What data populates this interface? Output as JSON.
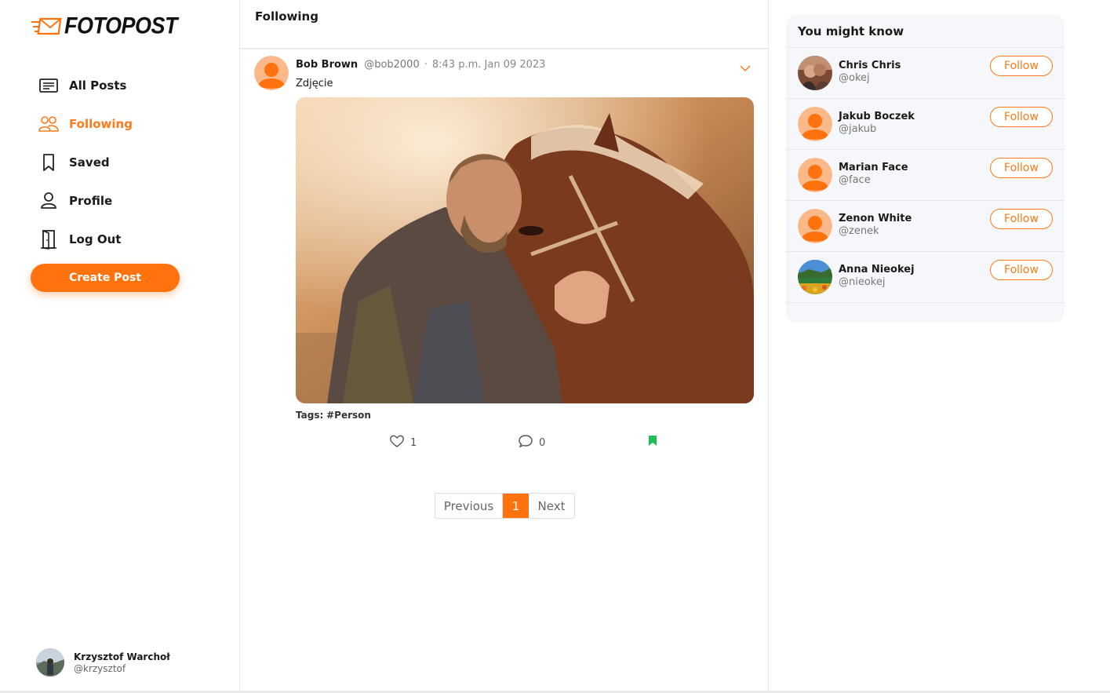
{
  "brand": {
    "name": "FOTOPOST",
    "accent": "#ff720d"
  },
  "sidebar": {
    "items": [
      {
        "label": "All Posts",
        "icon": "document-lines-icon",
        "active": false
      },
      {
        "label": "Following",
        "icon": "people-icon",
        "active": true
      },
      {
        "label": "Saved",
        "icon": "bookmark-icon",
        "active": false
      },
      {
        "label": "Profile",
        "icon": "user-icon",
        "active": false
      },
      {
        "label": "Log Out",
        "icon": "door-exit-icon",
        "active": false
      }
    ],
    "create_label": "Create Post",
    "current_user": {
      "name": "Krzysztof Warchoł",
      "handle": "@krzysztof"
    }
  },
  "feed": {
    "title": "Following",
    "posts": [
      {
        "author": "Bob Brown",
        "handle": "@bob2000",
        "separator": "·",
        "time": "8:43 p.m. Jan 09 2023",
        "text": "Zdjęcie",
        "tags_label": "Tags:",
        "tags": "#Person",
        "likes": "1",
        "comments": "0",
        "saved": true
      }
    ],
    "pagination": {
      "previous": "Previous",
      "current": "1",
      "next": "Next"
    }
  },
  "suggestions": {
    "title": "You might know",
    "follow_label": "Follow",
    "people": [
      {
        "name": "Chris Chris",
        "handle": "@okej"
      },
      {
        "name": "Jakub Boczek",
        "handle": "@jakub"
      },
      {
        "name": "Marian Face",
        "handle": "@face"
      },
      {
        "name": "Zenon White",
        "handle": "@zenek"
      },
      {
        "name": "Anna Nieokej",
        "handle": "@nieokej"
      }
    ]
  }
}
